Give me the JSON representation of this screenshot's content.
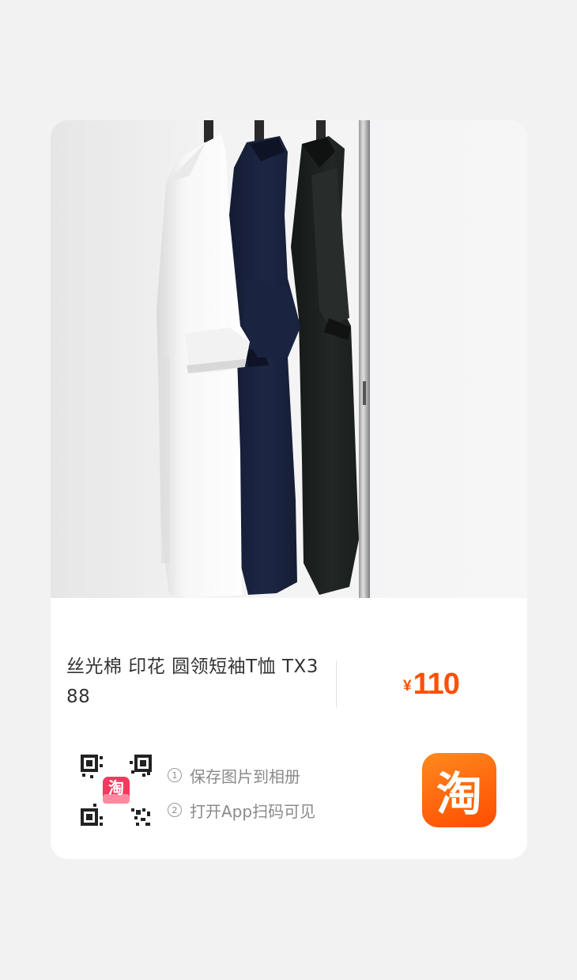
{
  "product": {
    "title": "丝光棉 印花 圆领短袖T恤 TX388",
    "price_currency": "¥",
    "price_amount": "110"
  },
  "share": {
    "qr_badge_text": "淘",
    "steps": [
      {
        "num": "1",
        "text": "保存图片到相册"
      },
      {
        "num": "2",
        "text": "打开App扫码可见"
      }
    ]
  },
  "brand": {
    "logo_text": "淘",
    "accent_color": "#ff5000"
  }
}
